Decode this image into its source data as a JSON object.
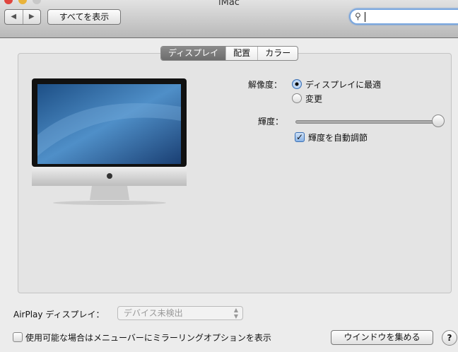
{
  "window": {
    "title": "iMac"
  },
  "toolbar": {
    "back": "◀",
    "forward": "▶",
    "show_all": "すべてを表示",
    "search_placeholder": "",
    "search_value": ""
  },
  "tabs": [
    {
      "label": "ディスプレイ",
      "active": true
    },
    {
      "label": "配置"
    },
    {
      "label": "カラー"
    }
  ],
  "display": {
    "resolution_label": "解像度：",
    "resolution_options": [
      {
        "label": "ディスプレイに最適",
        "selected": true
      },
      {
        "label": "変更",
        "selected": false
      }
    ],
    "brightness_label": "輝度：",
    "brightness_value": 0.97,
    "auto_brightness_label": "輝度を自動調節",
    "auto_brightness_checked": true
  },
  "airplay": {
    "label": "AirPlay ディスプレイ：",
    "value": "デバイス未検出"
  },
  "mirror_option": {
    "label": "使用可能な場合はメニューバーにミラーリングオプションを表示",
    "checked": false
  },
  "gather_windows": "ウインドウを集める",
  "help": "?",
  "colors": {
    "close": "#e0463f",
    "minimize": "#e9b33a",
    "zoom": "#c8c8c8",
    "accent": "#3a6fb3"
  }
}
